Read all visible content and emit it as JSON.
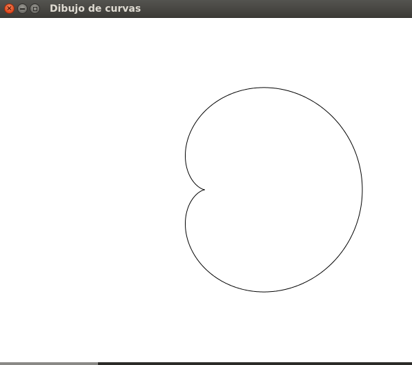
{
  "window": {
    "title": "Dibujo de curvas",
    "buttons": {
      "close": "close-icon",
      "minimize": "minimize-icon",
      "maximize": "maximize-icon"
    }
  },
  "curve": {
    "type": "cardioid",
    "stroke_color": "#000000",
    "background_color": "#ffffff"
  }
}
